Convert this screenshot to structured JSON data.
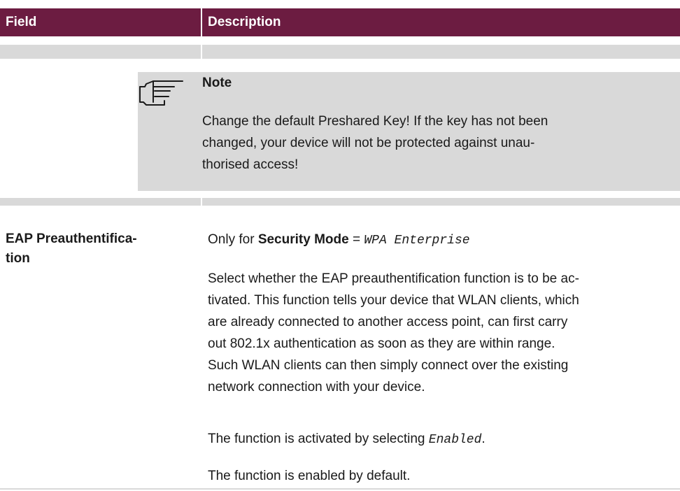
{
  "table": {
    "header": {
      "field": "Field",
      "description": "Description"
    }
  },
  "note": {
    "title": "Note",
    "body_line1": "Change the default Preshared Key! If the key has not been",
    "body_line2": "changed, your device will not be protected against unau-",
    "body_line3": "thorised access!"
  },
  "row": {
    "field_line1": "EAP Preauthentifica-",
    "field_line2": "tion",
    "only_for_prefix": "Only for ",
    "only_for_field": "Security Mode",
    "only_for_eq": " = ",
    "only_for_value": "WPA Enterprise",
    "para1": [
      "Select whether the EAP preauthentification function is to be ac-",
      "tivated. This function tells your device that WLAN clients, which",
      "are already connected to another access point, can first carry",
      "out 802.1x authentication as soon as they are within range.",
      "Such WLAN clients can then simply connect over the existing",
      "network connection with your device."
    ],
    "para2_prefix": "The function is activated by selecting ",
    "para2_value": "Enabled",
    "para2_suffix": ".",
    "para3": "The function is enabled by default."
  },
  "icons": {
    "note": "pointing-hand-icon"
  }
}
